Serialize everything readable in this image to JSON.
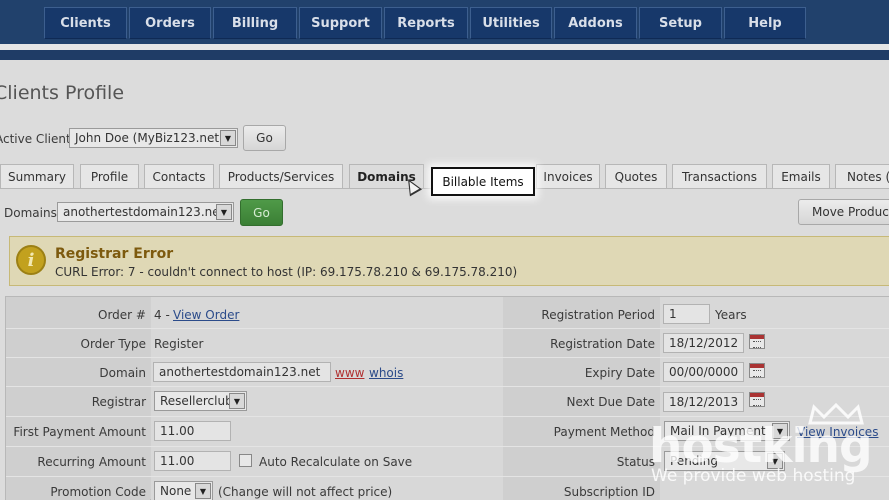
{
  "nav": [
    "Clients",
    "Orders",
    "Billing",
    "Support",
    "Reports",
    "Utilities",
    "Addons",
    "Setup",
    "Help"
  ],
  "page_title": "Clients Profile",
  "active_client": {
    "label": "Active Client:",
    "value": "John Doe (MyBiz123.net)",
    "go": "Go"
  },
  "tabs": [
    "Summary",
    "Profile",
    "Contacts",
    "Products/Services",
    "Domains",
    "Invoices",
    "Quotes",
    "Transactions",
    "Emails",
    "Notes ("
  ],
  "active_tab": "Domains",
  "highlight_button": "Billable Items",
  "domains_bar": {
    "label": "Domains:",
    "value": "anothertestdomain123.net",
    "go": "Go",
    "move": "Move Product"
  },
  "error": {
    "title": "Registrar Error",
    "message": "CURL Error: 7 - couldn't connect to host (IP: 69.175.78.210 & 69.175.78.210)",
    "icon": "info-icon"
  },
  "details": {
    "order_label": "Order #",
    "order_value": "4 - ",
    "order_link": "View Order",
    "order_type_label": "Order Type",
    "order_type_value": "Register",
    "domain_label": "Domain",
    "domain_value": "anothertestdomain123.net",
    "www": "www",
    "whois": "whois",
    "registrar_label": "Registrar",
    "registrar_value": "Resellerclub",
    "first_payment_label": "First Payment Amount",
    "first_payment_value": "11.00",
    "recurring_label": "Recurring Amount",
    "recurring_value": "11.00",
    "auto_recalc": "Auto Recalculate on Save",
    "promo_label": "Promotion Code",
    "promo_value": "None",
    "promo_note": "(Change will not affect price)",
    "reg_period_label": "Registration Period",
    "reg_period_value": "1",
    "reg_period_unit": "Years",
    "reg_date_label": "Registration Date",
    "reg_date_value": "18/12/2012",
    "expiry_label": "Expiry Date",
    "expiry_value": "00/00/0000",
    "next_due_label": "Next Due Date",
    "next_due_value": "18/12/2013",
    "payment_method_label": "Payment Method",
    "payment_method_value": "Mail In Payment",
    "view_invoices": "View Invoices",
    "status_label": "Status",
    "status_value": "Pending",
    "subscription_label": "Subscription ID"
  },
  "watermark": {
    "brand": "hostking",
    "tagline": "We provide web hosting"
  },
  "colors": {
    "nav_bg": "#21416c",
    "nav_button": "#17386a",
    "go_green": "#3b7f35",
    "error_title": "#7d5a0e",
    "link_blue": "#2b4b8a",
    "link_red": "#b03030"
  }
}
